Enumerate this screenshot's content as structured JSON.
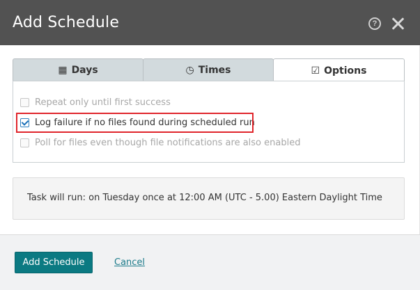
{
  "dialog": {
    "title": "Add Schedule",
    "help_icon": "help-circle-icon",
    "help_glyph": "?",
    "close_icon": "close-icon"
  },
  "tabs": [
    {
      "label": "Days",
      "icon": "calendar-icon",
      "glyph": "▦",
      "active": false
    },
    {
      "label": "Times",
      "icon": "clock-icon",
      "glyph": "◷",
      "active": false
    },
    {
      "label": "Options",
      "icon": "checked-square-icon",
      "glyph": "☑",
      "active": true
    }
  ],
  "options": [
    {
      "label": "Repeat only until first success",
      "checked": false,
      "disabled": true
    },
    {
      "label": "Log failure if no files found during scheduled run",
      "checked": true,
      "disabled": false
    },
    {
      "label": "Poll for files even though file notifications are also enabled",
      "checked": false,
      "disabled": true
    }
  ],
  "summary": {
    "text": "Task will run: on Tuesday once at 12:00 AM (UTC - 5.00) Eastern Daylight Time"
  },
  "footer": {
    "primary_label": "Add Schedule",
    "cancel_label": "Cancel"
  },
  "colors": {
    "header_bg": "#525252",
    "primary": "#0b7a82",
    "link": "#1c7b8a",
    "highlight": "#e0252b",
    "tab_inactive": "#d2dadd"
  }
}
